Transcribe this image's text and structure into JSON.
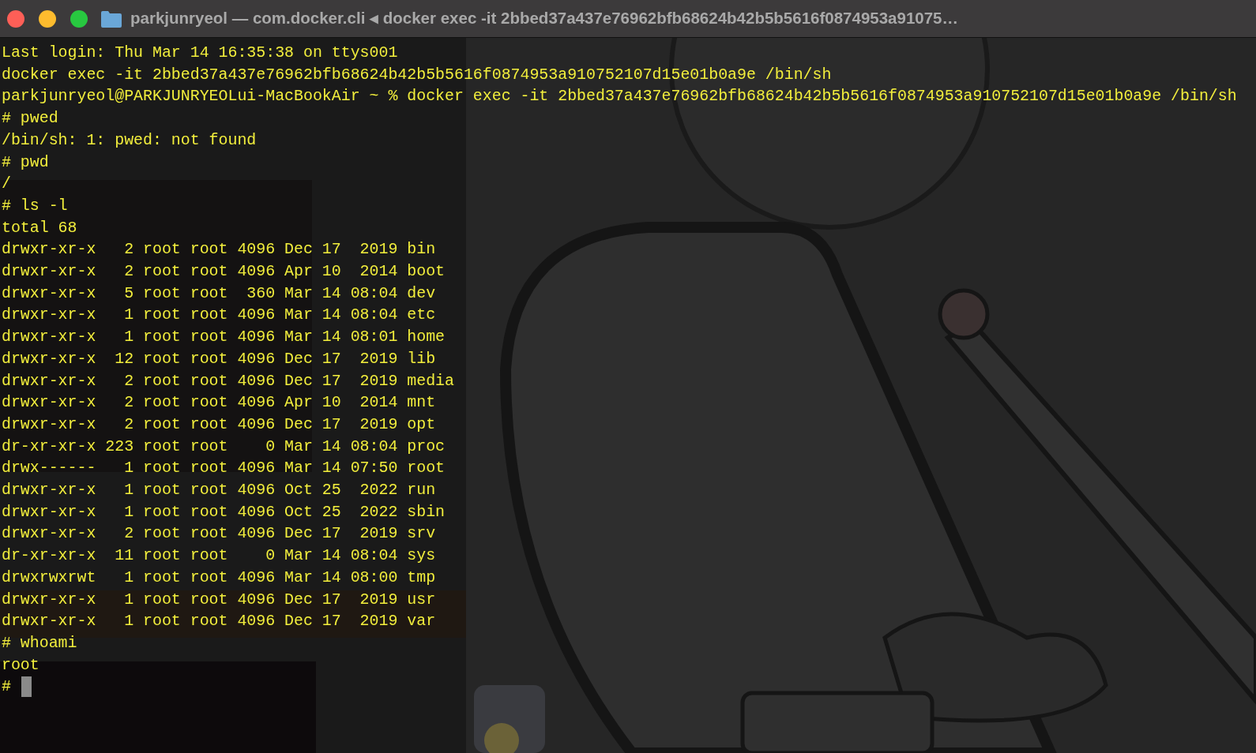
{
  "window": {
    "title": "parkjunryeol — com.docker.cli ◂ docker exec -it 2bbed37a437e76962bfb68624b42b5b5616f0874953a91075…"
  },
  "terminal": {
    "lines": [
      "Last login: Thu Mar 14 16:35:38 on ttys001",
      "docker exec -it 2bbed37a437e76962bfb68624b42b5b5616f0874953a910752107d15e01b0a9e /bin/sh",
      "parkjunryeol@PARKJUNRYEOLui-MacBookAir ~ % docker exec -it 2bbed37a437e76962bfb68624b42b5b5616f0874953a910752107d15e01b0a9e /bin/sh",
      "# pwed",
      "/bin/sh: 1: pwed: not found",
      "# pwd",
      "/",
      "# ls -l",
      "total 68",
      "drwxr-xr-x   2 root root 4096 Dec 17  2019 bin",
      "drwxr-xr-x   2 root root 4096 Apr 10  2014 boot",
      "drwxr-xr-x   5 root root  360 Mar 14 08:04 dev",
      "drwxr-xr-x   1 root root 4096 Mar 14 08:04 etc",
      "drwxr-xr-x   1 root root 4096 Mar 14 08:01 home",
      "drwxr-xr-x  12 root root 4096 Dec 17  2019 lib",
      "drwxr-xr-x   2 root root 4096 Dec 17  2019 media",
      "drwxr-xr-x   2 root root 4096 Apr 10  2014 mnt",
      "drwxr-xr-x   2 root root 4096 Dec 17  2019 opt",
      "dr-xr-xr-x 223 root root    0 Mar 14 08:04 proc",
      "drwx------   1 root root 4096 Mar 14 07:50 root",
      "drwxr-xr-x   1 root root 4096 Oct 25  2022 run",
      "drwxr-xr-x   1 root root 4096 Oct 25  2022 sbin",
      "drwxr-xr-x   2 root root 4096 Dec 17  2019 srv",
      "dr-xr-xr-x  11 root root    0 Mar 14 08:04 sys",
      "drwxrwxrwt   1 root root 4096 Mar 14 08:00 tmp",
      "drwxr-xr-x   1 root root 4096 Dec 17  2019 usr",
      "drwxr-xr-x   1 root root 4096 Dec 17  2019 var",
      "# whoami",
      "root"
    ],
    "prompt": "#"
  }
}
